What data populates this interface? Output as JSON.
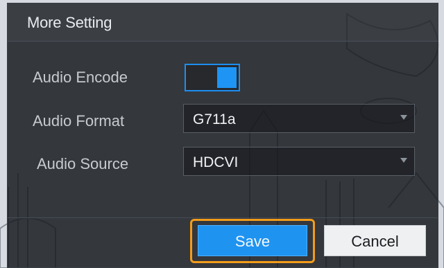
{
  "dialog": {
    "title": "More Setting",
    "audio_encode": {
      "label": "Audio Encode",
      "enabled": true
    },
    "audio_format": {
      "label": "Audio Format",
      "value": "G711a"
    },
    "audio_source": {
      "label": "Audio Source",
      "value": "HDCVI"
    },
    "buttons": {
      "save": "Save",
      "cancel": "Cancel"
    }
  },
  "colors": {
    "accent": "#1f93f0",
    "highlight": "#f39c1a",
    "panel": "#181c21"
  }
}
